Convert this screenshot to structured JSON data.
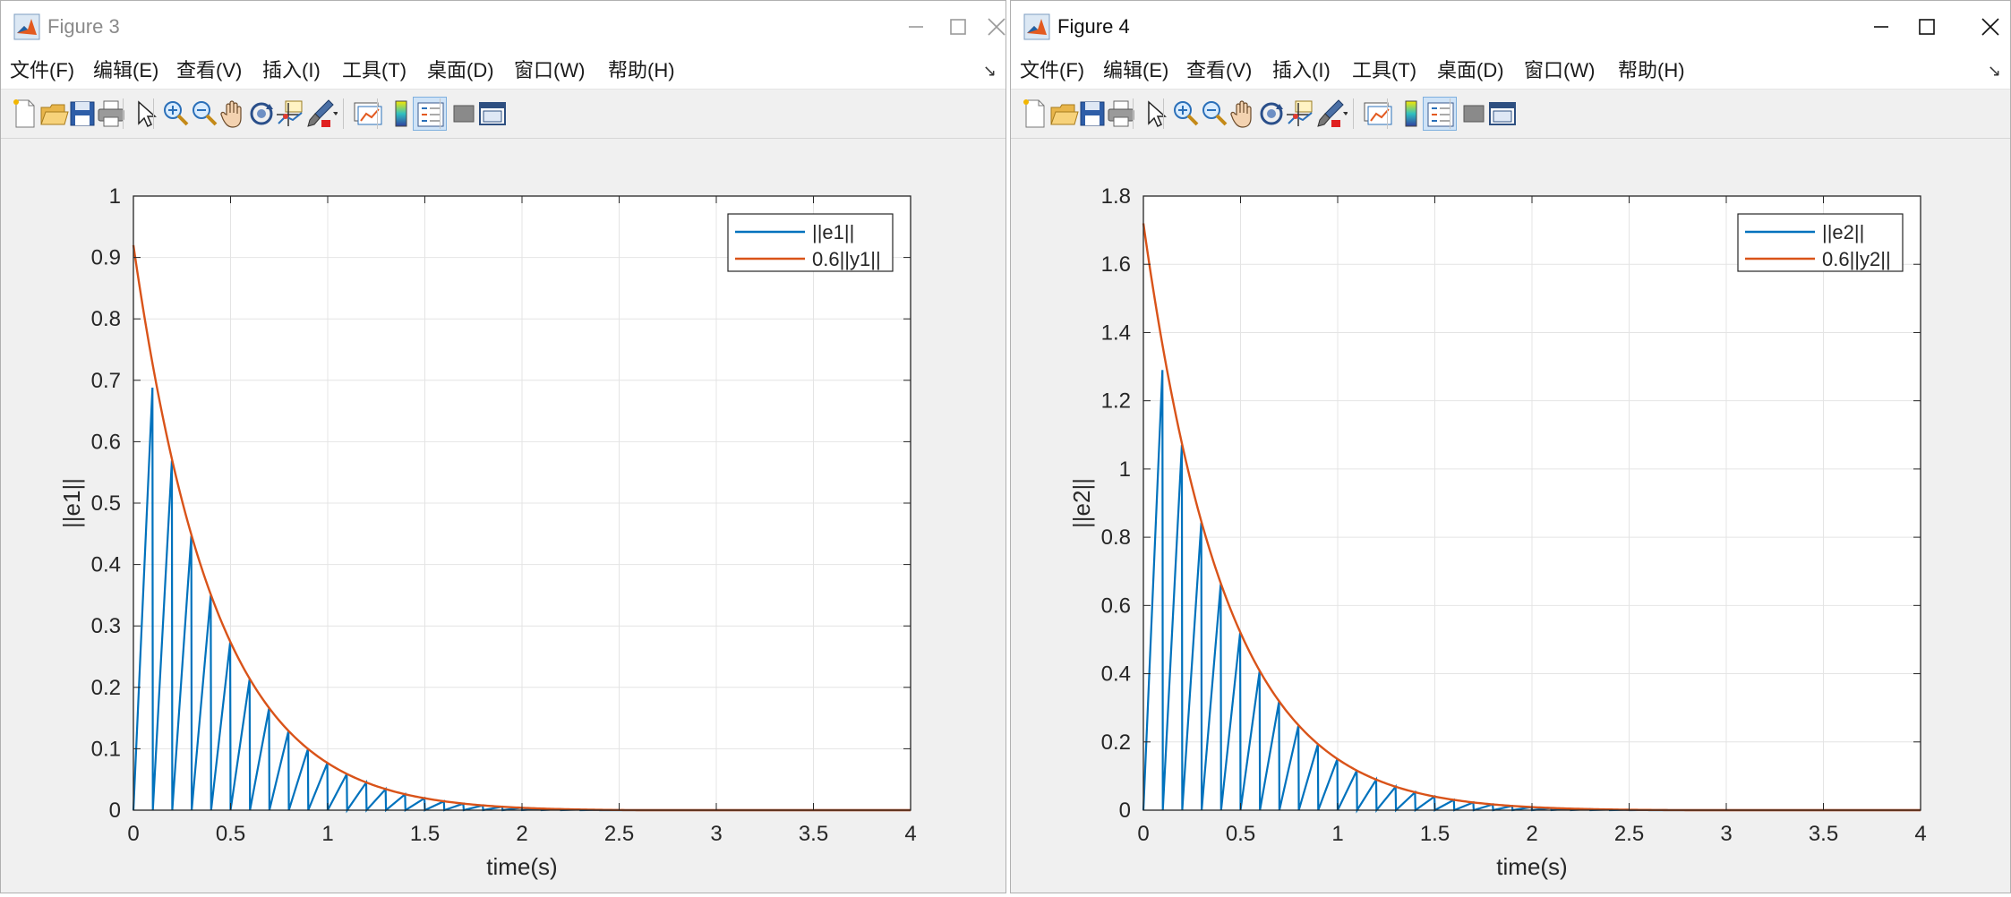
{
  "figures": [
    {
      "title": "Figure 3",
      "active": false,
      "menu": [
        "文件(F)",
        "编辑(E)",
        "查看(V)",
        "插入(I)",
        "工具(T)",
        "桌面(D)",
        "窗口(W)",
        "帮助(H)"
      ],
      "toolbar": [
        "new-figure-icon",
        "open-file-icon",
        "save-icon",
        "print-icon",
        "pointer-icon",
        "zoom-in-icon",
        "zoom-out-icon",
        "pan-hand-icon",
        "rotate-3d-icon",
        "data-cursor-icon",
        "brush-icon",
        "link-plot-icon",
        "colorbar-icon",
        "legend-icon",
        "hide-tools-icon",
        "dock-figure-icon"
      ],
      "chart_data": {
        "type": "line",
        "xlabel": "time(s)",
        "ylabel": "||e1||",
        "xlim": [
          0,
          4
        ],
        "ylim": [
          0,
          1
        ],
        "xticks": [
          "0",
          "0.5",
          "1",
          "1.5",
          "2",
          "2.5",
          "3",
          "3.5",
          "4"
        ],
        "yticks": [
          "0",
          "0.1",
          "0.2",
          "0.3",
          "0.4",
          "0.5",
          "0.6",
          "0.7",
          "0.8",
          "0.9",
          "1"
        ],
        "grid": true,
        "legend_position": "top-right",
        "series": [
          {
            "name": "||e1||",
            "color": "#0072BD",
            "style": "sawtooth",
            "reset_period": 0.1,
            "envelope_y0": 0.92,
            "envelope_tau": 0.5,
            "vanish_after": 2.0
          },
          {
            "name": "0.6||y1||",
            "color": "#D95319",
            "style": "curve",
            "x": [
              0,
              0.25,
              0.5,
              0.75,
              1,
              1.25,
              1.5,
              1.75,
              2,
              2.5,
              3,
              3.5,
              4
            ],
            "y": [
              0.92,
              0.56,
              0.37,
              0.21,
              0.12,
              0.06,
              0.028,
              0.01,
              0.003,
              0,
              0,
              0,
              0
            ]
          }
        ]
      }
    },
    {
      "title": "Figure 4",
      "active": true,
      "menu": [
        "文件(F)",
        "编辑(E)",
        "查看(V)",
        "插入(I)",
        "工具(T)",
        "桌面(D)",
        "窗口(W)",
        "帮助(H)"
      ],
      "toolbar": [
        "new-figure-icon",
        "open-file-icon",
        "save-icon",
        "print-icon",
        "pointer-icon",
        "zoom-in-icon",
        "zoom-out-icon",
        "pan-hand-icon",
        "rotate-3d-icon",
        "data-cursor-icon",
        "brush-icon",
        "link-plot-icon",
        "colorbar-icon",
        "legend-icon",
        "hide-tools-icon",
        "dock-figure-icon"
      ],
      "chart_data": {
        "type": "line",
        "xlabel": "time(s)",
        "ylabel": "||e2||",
        "xlim": [
          0,
          4
        ],
        "ylim": [
          0,
          1.8
        ],
        "xticks": [
          "0",
          "0.5",
          "1",
          "1.5",
          "2",
          "2.5",
          "3",
          "3.5",
          "4"
        ],
        "yticks": [
          "0",
          "0.2",
          "0.4",
          "0.6",
          "0.8",
          "1",
          "1.2",
          "1.4",
          "1.6",
          "1.8"
        ],
        "grid": true,
        "legend_position": "top-right",
        "series": [
          {
            "name": "||e2||",
            "color": "#0072BD",
            "style": "sawtooth",
            "reset_period": 0.1,
            "envelope_y0": 1.72,
            "envelope_tau": 0.5,
            "vanish_after": 2.2
          },
          {
            "name": "0.6||y2||",
            "color": "#D95319",
            "style": "curve",
            "x": [
              0,
              0.25,
              0.5,
              0.75,
              1,
              1.25,
              1.5,
              1.75,
              2,
              2.5,
              3,
              3.5,
              4
            ],
            "y": [
              1.72,
              1.15,
              0.75,
              0.47,
              0.28,
              0.15,
              0.075,
              0.035,
              0.015,
              0.002,
              0,
              0,
              0
            ]
          }
        ]
      }
    }
  ]
}
